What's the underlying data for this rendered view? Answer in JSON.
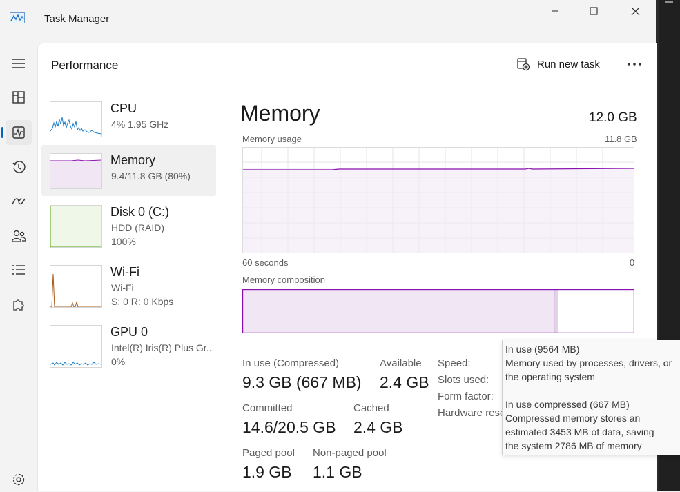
{
  "window": {
    "title": "Task Manager"
  },
  "header": {
    "title": "Performance",
    "run_new_task": "Run new task"
  },
  "sidebar": {
    "items": [
      {
        "name": "CPU",
        "line1": "4%  1.95 GHz",
        "line2": ""
      },
      {
        "name": "Memory",
        "line1": "9.4/11.8 GB (80%)",
        "line2": ""
      },
      {
        "name": "Disk 0 (C:)",
        "line1": "HDD (RAID)",
        "line2": "100%"
      },
      {
        "name": "Wi-Fi",
        "line1": "Wi-Fi",
        "line2": "S: 0 R: 0 Kbps"
      },
      {
        "name": "GPU 0",
        "line1": "Intel(R) Iris(R) Plus Gr...",
        "line2": "0%"
      }
    ]
  },
  "main": {
    "title": "Memory",
    "total": "12.0 GB",
    "usage_label": "Memory usage",
    "usage_max": "11.8 GB",
    "time_left": "60 seconds",
    "time_right": "0",
    "composition_label": "Memory composition",
    "composition_in_use_fraction": 0.805,
    "usage_level_fraction": 0.8,
    "stats": {
      "in_use_label": "In use (Compressed)",
      "in_use_value": "9.3 GB (667 MB)",
      "available_label": "Available",
      "available_value": "2.4 GB",
      "committed_label": "Committed",
      "committed_value": "14.6/20.5 GB",
      "cached_label": "Cached",
      "cached_value": "2.4 GB",
      "paged_label": "Paged pool",
      "paged_value": "1.9 GB",
      "nonpaged_label": "Non-paged pool",
      "nonpaged_value": "1.1 GB"
    },
    "right_labels": {
      "speed": "Speed:",
      "slots": "Slots used:",
      "form": "Form factor:",
      "hw": "Hardware rese"
    }
  },
  "tooltip": {
    "line1": "In use (9564 MB)",
    "line2": "Memory used by processes, drivers, or",
    "line3": "the operating system",
    "line4": "In use compressed (667 MB)",
    "line5": "Compressed memory stores an",
    "line6": "estimated 3453 MB of data, saving",
    "line7": "the system 2786 MB of memory"
  },
  "colors": {
    "memory": "#8b12ae",
    "memory_fill": "#f1e6f4",
    "cpu": "#1a7dc4",
    "disk": "#4da60c",
    "disk_fill": "#eff8e8",
    "wifi": "#a7591a",
    "accent": "#0067c0"
  }
}
